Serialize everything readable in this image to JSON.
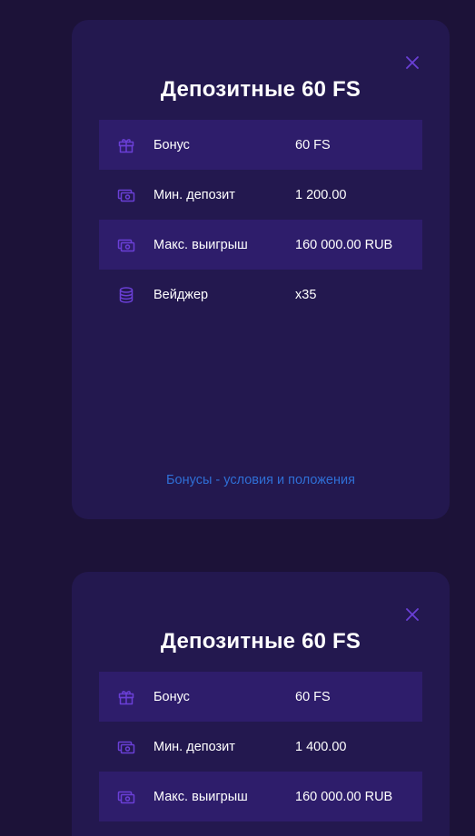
{
  "colors": {
    "background": "#1c1238",
    "card": "#23184f",
    "row_highlight": "#2e1d6b",
    "icon": "#6a3fd6",
    "link": "#2f6fd6",
    "text": "#ffffff"
  },
  "cards": [
    {
      "title": "Депозитные 60 FS",
      "rows": [
        {
          "icon": "gift-icon",
          "label": "Бонус",
          "value": "60 FS"
        },
        {
          "icon": "cash-icon",
          "label": "Мин. депозит",
          "value": "1 200.00"
        },
        {
          "icon": "cash-icon",
          "label": "Макс. выигрыш",
          "value": "160 000.00 RUB"
        },
        {
          "icon": "coins-stack-icon",
          "label": "Вейджер",
          "value": "x35"
        }
      ],
      "link_text": "Бонусы - условия и положения"
    },
    {
      "title": "Депозитные 60 FS",
      "rows": [
        {
          "icon": "gift-icon",
          "label": "Бонус",
          "value": "60 FS"
        },
        {
          "icon": "cash-icon",
          "label": "Мин. депозит",
          "value": "1 400.00"
        },
        {
          "icon": "cash-icon",
          "label": "Макс. выигрыш",
          "value": "160 000.00 RUB"
        }
      ]
    }
  ]
}
